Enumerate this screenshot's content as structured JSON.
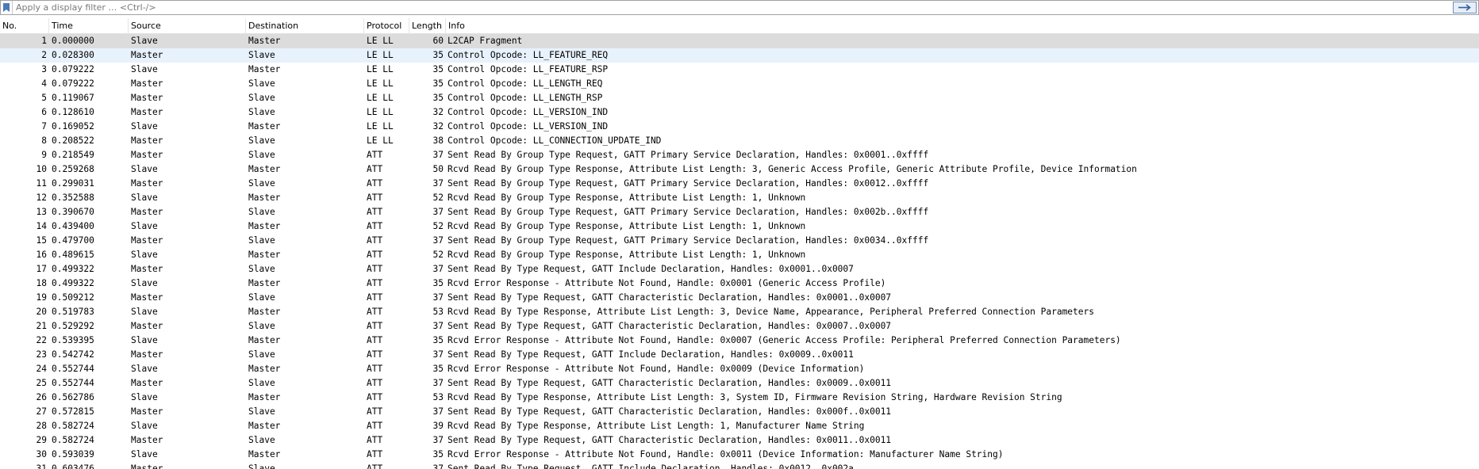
{
  "filter": {
    "placeholder": "Apply a display filter … <Ctrl-/>"
  },
  "columns": {
    "no": "No.",
    "time": "Time",
    "source": "Source",
    "destination": "Destination",
    "protocol": "Protocol",
    "length": "Length",
    "info": "Info"
  },
  "colors": {
    "selected_gray": "#dcdcdc",
    "selected_blue": "#e8f2fc"
  },
  "packets": [
    {
      "no": "1",
      "time": "0.000000",
      "source": "Slave",
      "destination": "Master",
      "protocol": "LE LL",
      "length": "60",
      "info": "L2CAP Fragment"
    },
    {
      "no": "2",
      "time": "0.028300",
      "source": "Master",
      "destination": "Slave",
      "protocol": "LE LL",
      "length": "35",
      "info": "Control Opcode: LL_FEATURE_REQ"
    },
    {
      "no": "3",
      "time": "0.079222",
      "source": "Slave",
      "destination": "Master",
      "protocol": "LE LL",
      "length": "35",
      "info": "Control Opcode: LL_FEATURE_RSP"
    },
    {
      "no": "4",
      "time": "0.079222",
      "source": "Master",
      "destination": "Slave",
      "protocol": "LE LL",
      "length": "35",
      "info": "Control Opcode: LL_LENGTH_REQ"
    },
    {
      "no": "5",
      "time": "0.119067",
      "source": "Master",
      "destination": "Slave",
      "protocol": "LE LL",
      "length": "35",
      "info": "Control Opcode: LL_LENGTH_RSP"
    },
    {
      "no": "6",
      "time": "0.128610",
      "source": "Master",
      "destination": "Slave",
      "protocol": "LE LL",
      "length": "32",
      "info": "Control Opcode: LL_VERSION_IND"
    },
    {
      "no": "7",
      "time": "0.169052",
      "source": "Slave",
      "destination": "Master",
      "protocol": "LE LL",
      "length": "32",
      "info": "Control Opcode: LL_VERSION_IND"
    },
    {
      "no": "8",
      "time": "0.208522",
      "source": "Master",
      "destination": "Slave",
      "protocol": "LE LL",
      "length": "38",
      "info": "Control Opcode: LL_CONNECTION_UPDATE_IND"
    },
    {
      "no": "9",
      "time": "0.218549",
      "source": "Master",
      "destination": "Slave",
      "protocol": "ATT",
      "length": "37",
      "info": "Sent Read By Group Type Request, GATT Primary Service Declaration, Handles: 0x0001..0xffff"
    },
    {
      "no": "10",
      "time": "0.259268",
      "source": "Slave",
      "destination": "Master",
      "protocol": "ATT",
      "length": "50",
      "info": "Rcvd Read By Group Type Response, Attribute List Length: 3, Generic Access Profile, Generic Attribute Profile, Device Information"
    },
    {
      "no": "11",
      "time": "0.299031",
      "source": "Master",
      "destination": "Slave",
      "protocol": "ATT",
      "length": "37",
      "info": "Sent Read By Group Type Request, GATT Primary Service Declaration, Handles: 0x0012..0xffff"
    },
    {
      "no": "12",
      "time": "0.352588",
      "source": "Slave",
      "destination": "Master",
      "protocol": "ATT",
      "length": "52",
      "info": "Rcvd Read By Group Type Response, Attribute List Length: 1, Unknown"
    },
    {
      "no": "13",
      "time": "0.390670",
      "source": "Master",
      "destination": "Slave",
      "protocol": "ATT",
      "length": "37",
      "info": "Sent Read By Group Type Request, GATT Primary Service Declaration, Handles: 0x002b..0xffff"
    },
    {
      "no": "14",
      "time": "0.439400",
      "source": "Slave",
      "destination": "Master",
      "protocol": "ATT",
      "length": "52",
      "info": "Rcvd Read By Group Type Response, Attribute List Length: 1, Unknown"
    },
    {
      "no": "15",
      "time": "0.479700",
      "source": "Master",
      "destination": "Slave",
      "protocol": "ATT",
      "length": "37",
      "info": "Sent Read By Group Type Request, GATT Primary Service Declaration, Handles: 0x0034..0xffff"
    },
    {
      "no": "16",
      "time": "0.489615",
      "source": "Slave",
      "destination": "Master",
      "protocol": "ATT",
      "length": "52",
      "info": "Rcvd Read By Group Type Response, Attribute List Length: 1, Unknown"
    },
    {
      "no": "17",
      "time": "0.499322",
      "source": "Master",
      "destination": "Slave",
      "protocol": "ATT",
      "length": "37",
      "info": "Sent Read By Type Request, GATT Include Declaration, Handles: 0x0001..0x0007"
    },
    {
      "no": "18",
      "time": "0.499322",
      "source": "Slave",
      "destination": "Master",
      "protocol": "ATT",
      "length": "35",
      "info": "Rcvd Error Response - Attribute Not Found, Handle: 0x0001 (Generic Access Profile)"
    },
    {
      "no": "19",
      "time": "0.509212",
      "source": "Master",
      "destination": "Slave",
      "protocol": "ATT",
      "length": "37",
      "info": "Sent Read By Type Request, GATT Characteristic Declaration, Handles: 0x0001..0x0007"
    },
    {
      "no": "20",
      "time": "0.519783",
      "source": "Slave",
      "destination": "Master",
      "protocol": "ATT",
      "length": "53",
      "info": "Rcvd Read By Type Response, Attribute List Length: 3, Device Name, Appearance, Peripheral Preferred Connection Parameters"
    },
    {
      "no": "21",
      "time": "0.529292",
      "source": "Master",
      "destination": "Slave",
      "protocol": "ATT",
      "length": "37",
      "info": "Sent Read By Type Request, GATT Characteristic Declaration, Handles: 0x0007..0x0007"
    },
    {
      "no": "22",
      "time": "0.539395",
      "source": "Slave",
      "destination": "Master",
      "protocol": "ATT",
      "length": "35",
      "info": "Rcvd Error Response - Attribute Not Found, Handle: 0x0007 (Generic Access Profile: Peripheral Preferred Connection Parameters)"
    },
    {
      "no": "23",
      "time": "0.542742",
      "source": "Master",
      "destination": "Slave",
      "protocol": "ATT",
      "length": "37",
      "info": "Sent Read By Type Request, GATT Include Declaration, Handles: 0x0009..0x0011"
    },
    {
      "no": "24",
      "time": "0.552744",
      "source": "Slave",
      "destination": "Master",
      "protocol": "ATT",
      "length": "35",
      "info": "Rcvd Error Response - Attribute Not Found, Handle: 0x0009 (Device Information)"
    },
    {
      "no": "25",
      "time": "0.552744",
      "source": "Master",
      "destination": "Slave",
      "protocol": "ATT",
      "length": "37",
      "info": "Sent Read By Type Request, GATT Characteristic Declaration, Handles: 0x0009..0x0011"
    },
    {
      "no": "26",
      "time": "0.562786",
      "source": "Slave",
      "destination": "Master",
      "protocol": "ATT",
      "length": "53",
      "info": "Rcvd Read By Type Response, Attribute List Length: 3, System ID, Firmware Revision String, Hardware Revision String"
    },
    {
      "no": "27",
      "time": "0.572815",
      "source": "Master",
      "destination": "Slave",
      "protocol": "ATT",
      "length": "37",
      "info": "Sent Read By Type Request, GATT Characteristic Declaration, Handles: 0x000f..0x0011"
    },
    {
      "no": "28",
      "time": "0.582724",
      "source": "Slave",
      "destination": "Master",
      "protocol": "ATT",
      "length": "39",
      "info": "Rcvd Read By Type Response, Attribute List Length: 1, Manufacturer Name String"
    },
    {
      "no": "29",
      "time": "0.582724",
      "source": "Master",
      "destination": "Slave",
      "protocol": "ATT",
      "length": "37",
      "info": "Sent Read By Type Request, GATT Characteristic Declaration, Handles: 0x0011..0x0011"
    },
    {
      "no": "30",
      "time": "0.593039",
      "source": "Slave",
      "destination": "Master",
      "protocol": "ATT",
      "length": "35",
      "info": "Rcvd Error Response - Attribute Not Found, Handle: 0x0011 (Device Information: Manufacturer Name String)"
    },
    {
      "no": "31",
      "time": "0.603476",
      "source": "Master",
      "destination": "Slave",
      "protocol": "ATT",
      "length": "37",
      "info": "Sent Read By Type Request, GATT Include Declaration, Handles: 0x0012..0x002a"
    }
  ]
}
